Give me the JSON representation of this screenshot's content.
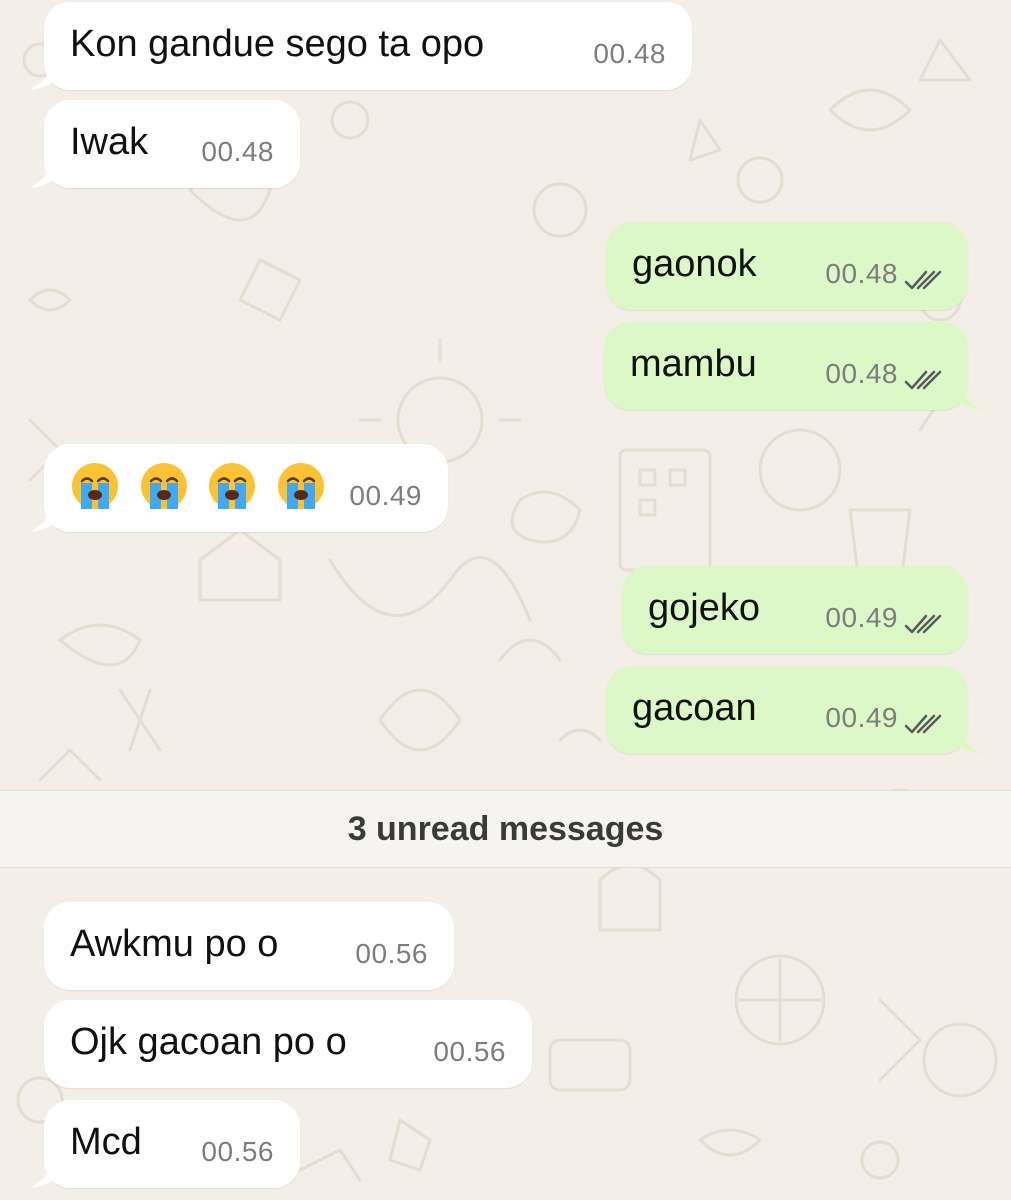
{
  "chat": {
    "messages": [
      {
        "direction": "incoming",
        "text": "Kon gandue sego ta opo",
        "time": "00.48"
      },
      {
        "direction": "incoming",
        "text": "Iwak",
        "time": "00.48"
      },
      {
        "direction": "outgoing",
        "text": "gaonok",
        "time": "00.48",
        "status": "read"
      },
      {
        "direction": "outgoing",
        "text": "mambu",
        "time": "00.48",
        "status": "read"
      },
      {
        "direction": "incoming",
        "emoji": [
          "loudly-crying-face",
          "loudly-crying-face",
          "loudly-crying-face",
          "loudly-crying-face"
        ],
        "time": "00.49"
      },
      {
        "direction": "outgoing",
        "text": "gojeko",
        "time": "00.49",
        "status": "read"
      },
      {
        "direction": "outgoing",
        "text": "gacoan",
        "time": "00.49",
        "status": "read"
      },
      {
        "direction": "incoming",
        "text": "Awkmu po o",
        "time": "00.56"
      },
      {
        "direction": "incoming",
        "text": "Ojk gacoan po o",
        "time": "00.56"
      },
      {
        "direction": "incoming",
        "text": "Mcd",
        "time": "00.56"
      }
    ],
    "unread_banner": "3 unread messages"
  },
  "colors": {
    "background": "#f3efe8",
    "incoming_bubble": "#ffffff",
    "outgoing_bubble": "#dcf8c6",
    "timestamp": "#7d7d7d",
    "read_ticks": "#5a5a5a",
    "unread_banner_text": "#3a3a3a"
  }
}
